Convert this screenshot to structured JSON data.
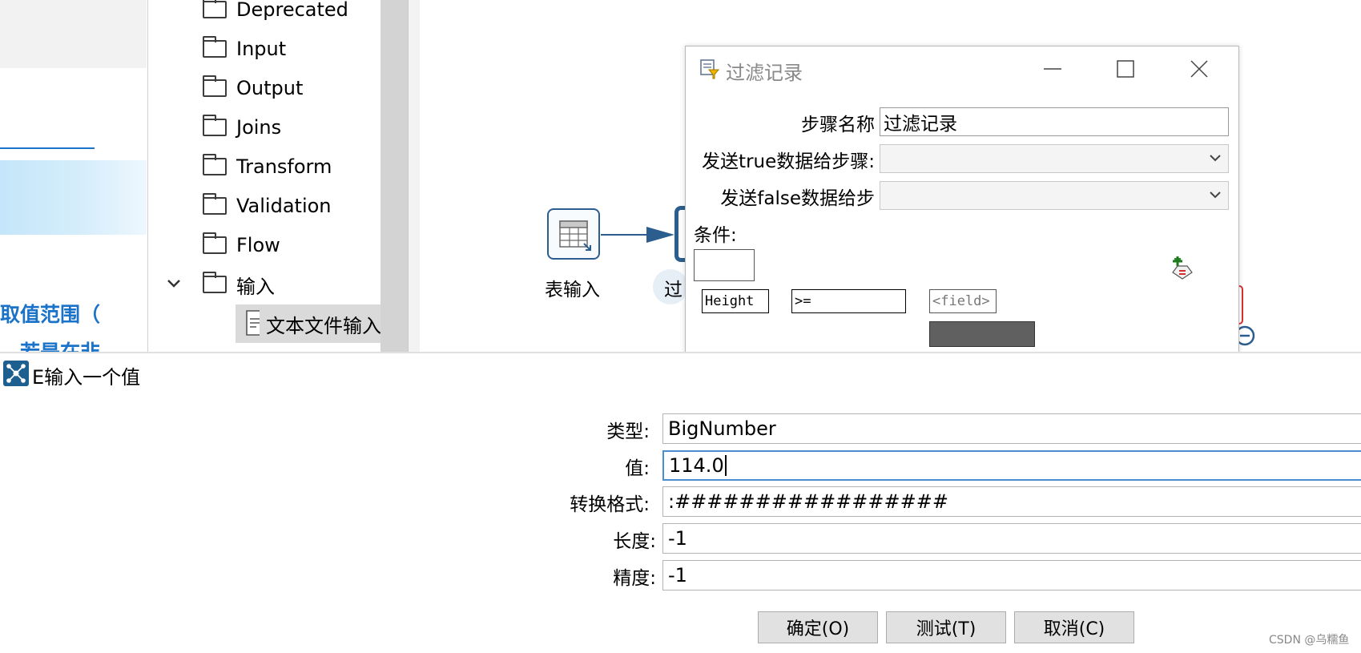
{
  "left_page": {
    "line1": "取值范围（",
    "line2": "若是在非"
  },
  "tree": {
    "items": [
      {
        "label": "Deprecated"
      },
      {
        "label": "Input"
      },
      {
        "label": "Output"
      },
      {
        "label": "Joins"
      },
      {
        "label": "Transform"
      },
      {
        "label": "Validation"
      },
      {
        "label": "Flow"
      },
      {
        "label": "输入"
      }
    ],
    "child_item": "文本文件输入"
  },
  "canvas": {
    "step1_label": "表输入",
    "step2_label": "过"
  },
  "filter_dialog": {
    "title": "过滤记录",
    "step_name_label": "步骤名称",
    "step_name_value": "过滤记录",
    "send_true_label": "发送true数据给步骤:",
    "send_false_label": "发送false数据给步",
    "condition_label": "条件:",
    "condition": {
      "field": "Height",
      "operator": ">=",
      "value": "<field>"
    }
  },
  "value_dialog": {
    "title": "E输入一个值",
    "type_label": "类型:",
    "type_value": "BigNumber",
    "value_label": "值:",
    "value_value": "114.0",
    "format_label": "转换格式:",
    "format_value": ":#################",
    "length_label": "长度:",
    "length_value": "-1",
    "precision_label": "精度:",
    "precision_value": "-1",
    "ok_button": "确定(O)",
    "test_button": "测试(T)",
    "cancel_button": "取消(C)"
  },
  "watermark": "CSDN @乌糯鱼",
  "colors": {
    "link_blue": "#1a73c8",
    "step_border": "#2b5d8f",
    "dialog_icon": "#1d5f8f"
  }
}
